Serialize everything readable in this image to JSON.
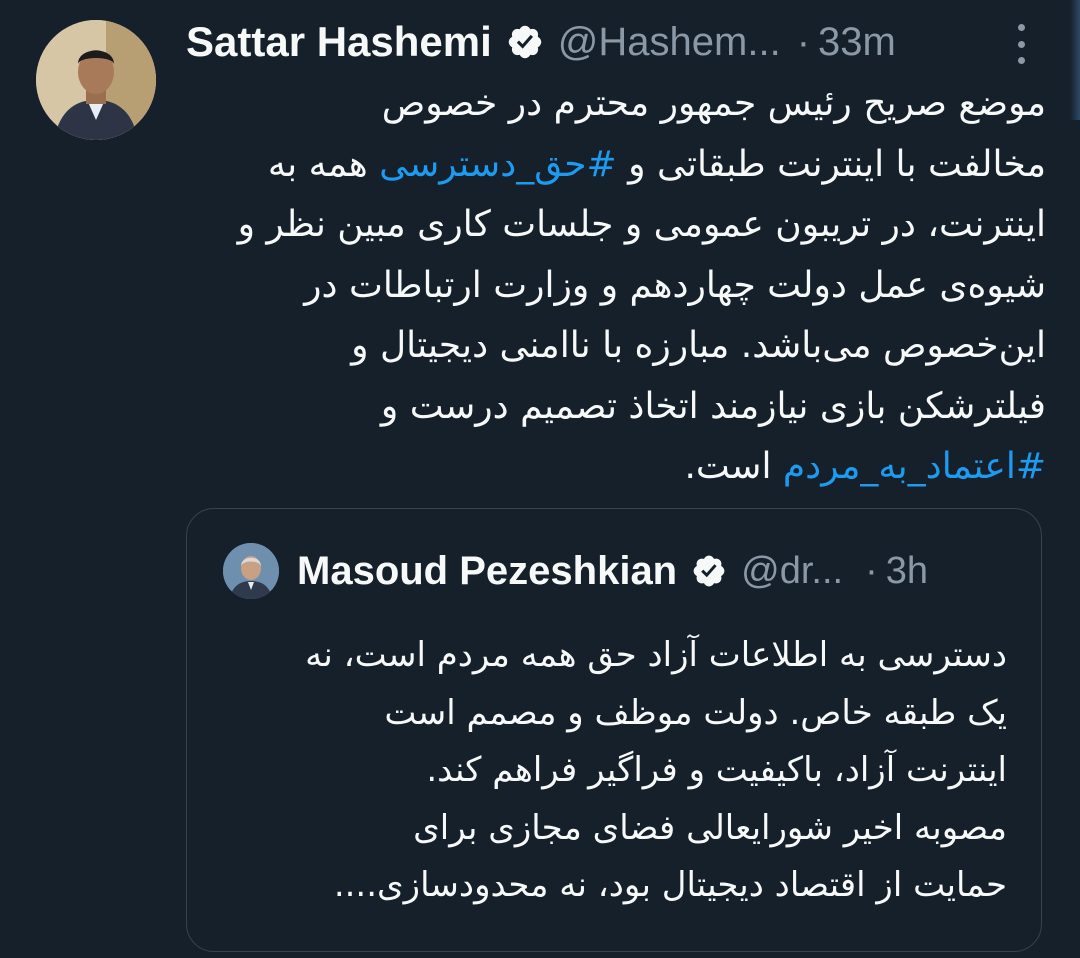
{
  "tweet": {
    "author_name": "Sattar Hashemi",
    "handle": "@Hashem...",
    "separator": "·",
    "time": "33m",
    "verified_icon": "verified-badge-icon",
    "more_icon": "more-vertical-icon",
    "lines": [
      {
        "parts": [
          {
            "text": "موضع صریح رئیس جمهور محترم در خصوص",
            "type": "text"
          }
        ]
      },
      {
        "parts": [
          {
            "text": "مخالفت با اینترنت طبقاتی و ",
            "type": "text"
          },
          {
            "text": "#حق_دسترسی",
            "type": "hashtag"
          },
          {
            "text": " همه به",
            "type": "text"
          }
        ]
      },
      {
        "parts": [
          {
            "text": "اینترنت، در تریبون عمومی و جلسات کاری مبین نظر و",
            "type": "text"
          }
        ]
      },
      {
        "parts": [
          {
            "text": "شیوه‌ی عمل دولت چهاردهم و وزارت ارتباطات در",
            "type": "text"
          }
        ]
      },
      {
        "parts": [
          {
            "text": "این‌خصوص می‌باشد. مبارزه با ناامنی دیجیتال و",
            "type": "text"
          }
        ]
      },
      {
        "parts": [
          {
            "text": "فیلترشکن بازی نیازمند اتخاذ تصمیم درست و",
            "type": "text"
          }
        ]
      },
      {
        "parts": [
          {
            "text": "#اعتماد_به_مردم",
            "type": "hashtag"
          },
          {
            "text": " است.",
            "type": "text"
          }
        ]
      }
    ]
  },
  "quoted_tweet": {
    "author_name": "Masoud Pezeshkian",
    "handle": "@dr...",
    "separator": "·",
    "time": "3h",
    "verified_icon": "verified-badge-icon",
    "lines": [
      "دسترسی به اطلاعات آزاد حق همه مردم است، نه",
      "یک طبقه خاص. دولت موظف و مصمم است",
      "اینترنت آزاد، باکیفیت و فراگیر فراهم کند.",
      "مصوبه اخیر شورایعالی فضای مجازی برای",
      "حمایت از اقتصاد دیجیتال بود، نه محدودسازی...."
    ]
  },
  "colors": {
    "background": "#15202b",
    "text": "#f7f9f9",
    "secondary": "#8b98a5",
    "link": "#1d9bf0",
    "border": "#38444d",
    "badge": "#f7f9f9"
  }
}
